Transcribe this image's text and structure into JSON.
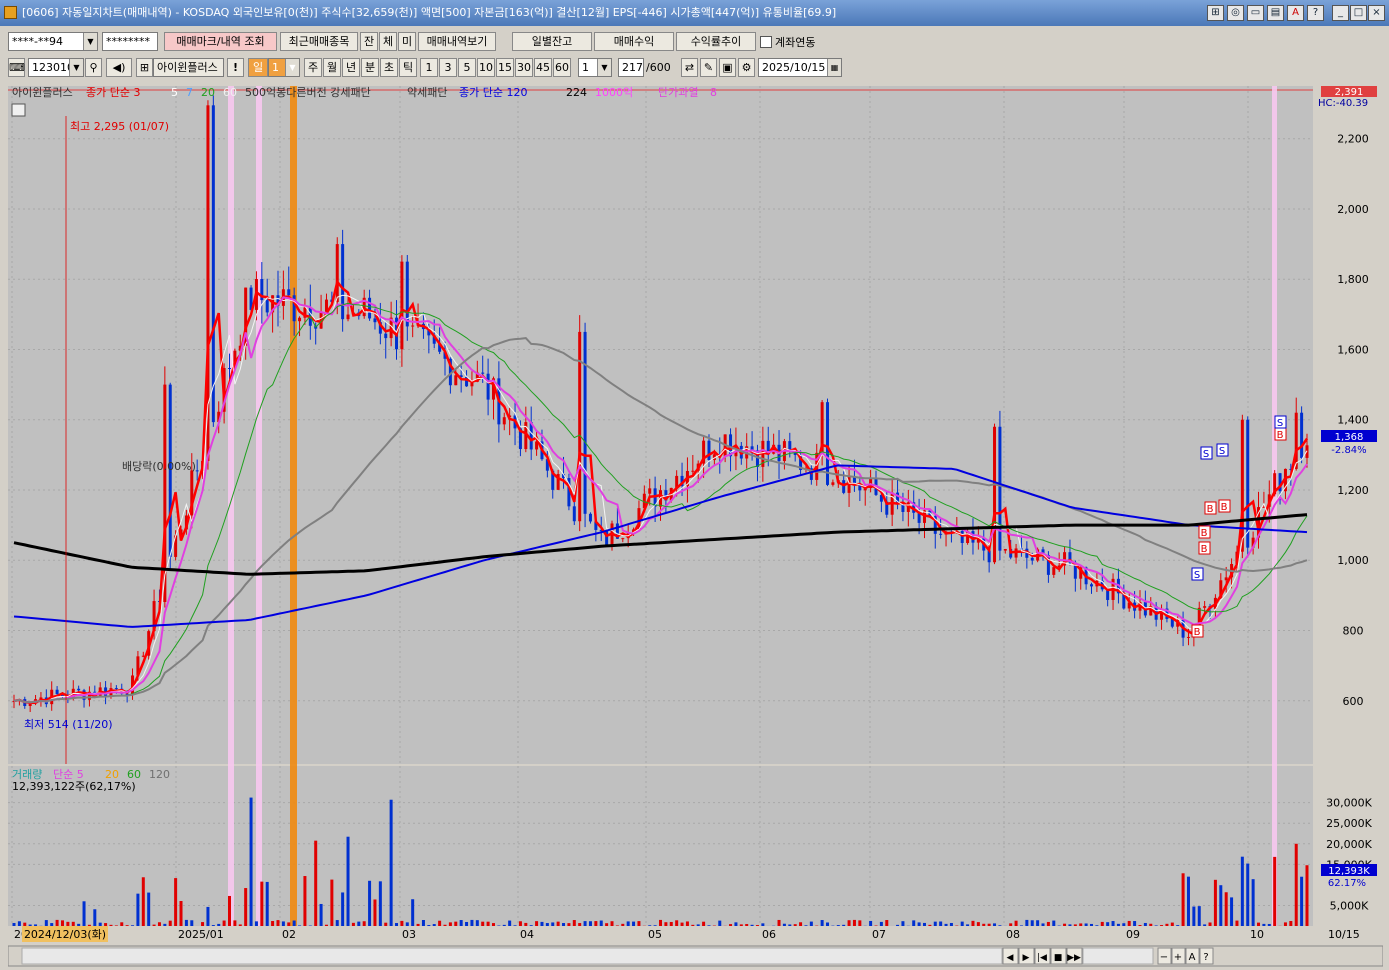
{
  "window": {
    "title": "[0606] 자동일지차트(매매내역) - KOSDAQ 외국인보유[0(천)] 주식수[32,659(천)] 액면[500] 자본금[163(억)] 결산[12월] EPS[-446] 시가총액[447(억)] 유통비율[69.9]"
  },
  "toolbar1": {
    "account": "****-**94",
    "password": "********",
    "btn_trade_mark": "매매마크/내역 조회",
    "btn_recent": "최근매매종목",
    "btn_jan": "잔",
    "btn_che": "체",
    "btn_mi": "미",
    "btn_view": "매매내역보기",
    "btn_daily": "일별잔고",
    "btn_profit": "매매수익",
    "btn_profit_trend": "수익률추이",
    "chk_link": "계좌연동"
  },
  "toolbar2": {
    "code": "123010",
    "name": "아이윈플러스",
    "period_day": "일",
    "period_num": "1",
    "periods": [
      "주",
      "월",
      "년",
      "분",
      "초",
      "틱"
    ],
    "intervals": [
      "1",
      "3",
      "5",
      "10",
      "15",
      "30",
      "45",
      "60"
    ],
    "interval_sel": "1",
    "count": "217",
    "count_total": "/600",
    "date": "2025/10/15"
  },
  "legend_main": [
    {
      "text": "아이윈플러스",
      "color": "#303030"
    },
    {
      "text": "종가 단순 3",
      "color": "#e00000"
    },
    {
      "text": "5",
      "color": "#ffffff"
    },
    {
      "text": "7",
      "color": "#50a0ff"
    },
    {
      "text": "20",
      "color": "#20a020"
    },
    {
      "text": "60",
      "color": "#f0f0f0"
    },
    {
      "text": "500억봉다른버전 강세패단",
      "color": "#303030"
    },
    {
      "text": "약세패단",
      "color": "#303030"
    },
    {
      "text": "종가 단순 120",
      "color": "#0000e0"
    },
    {
      "text": "224",
      "color": "#000000"
    },
    {
      "text": "1000억",
      "color": "#ff40ff"
    },
    {
      "text": "단가과열",
      "color": "#e040e0"
    },
    {
      "text": "8",
      "color": "#e040e0"
    }
  ],
  "legend_vol": [
    {
      "text": "거래량",
      "color": "#20a0a0"
    },
    {
      "text": "단순 5",
      "color": "#e040e0"
    },
    {
      "text": "20",
      "color": "#f0a000"
    },
    {
      "text": "60",
      "color": "#20a020"
    },
    {
      "text": "120",
      "color": "#707070"
    }
  ],
  "annotations": {
    "high": "최고 2,295 (01/07)",
    "low": "최저 514 (11/20)",
    "dividend": "배당락(0.00%)",
    "vol_info": "12,393,122주(62,17%)",
    "date_tag": "2024/12/03(화)",
    "hc": "HC:-40.39"
  },
  "price_panel": {
    "current": "2,391",
    "last": "1,368",
    "change": "-2.84%"
  },
  "vol_panel": {
    "last": "12,393K",
    "pct": "62.17%"
  },
  "axes": {
    "price_ticks": [
      "2,200",
      "2,000",
      "1,800",
      "1,600",
      "1,400",
      "1,200",
      "1,000",
      "800",
      "600"
    ],
    "price_values": [
      2200,
      2000,
      1800,
      1600,
      1400,
      1200,
      1000,
      800,
      600
    ],
    "vol_ticks": [
      "30,000K",
      "25,000K",
      "20,000K",
      "15,000K",
      "5,000K"
    ],
    "vol_values": [
      30000,
      25000,
      20000,
      15000,
      5000
    ],
    "x_labels": [
      "20",
      "2025/01",
      "02",
      "03",
      "04",
      "05",
      "06",
      "07",
      "08",
      "09",
      "10",
      "10/15"
    ]
  },
  "chart_data": {
    "type": "line",
    "xlabel": "",
    "ylabel": "",
    "x": [
      "2024-11",
      "2024-12",
      "2025-01",
      "2025-02",
      "2025-03",
      "2025-04",
      "2025-05",
      "2025-06",
      "2025-07",
      "2025-08",
      "2025-09",
      "2025-10"
    ],
    "series": [
      {
        "name": "종가",
        "values": [
          600,
          640,
          1750,
          1700,
          1500,
          1050,
          1350,
          1250,
          1050,
          980,
          790,
          1368
        ]
      },
      {
        "name": "종가 단순 120",
        "values": [
          840,
          810,
          830,
          900,
          1000,
          1080,
          1180,
          1270,
          1260,
          1150,
          1100,
          1080
        ]
      },
      {
        "name": "224",
        "values": [
          1050,
          980,
          960,
          970,
          1010,
          1040,
          1060,
          1080,
          1090,
          1100,
          1100,
          1130
        ]
      }
    ],
    "ylim": [
      420,
      2350
    ]
  },
  "bottom": {
    "scroll_btns": [
      "◀",
      "▶",
      "|◀",
      "■",
      "▶▶"
    ],
    "zoom": [
      "−",
      "+",
      "A",
      "?"
    ]
  }
}
